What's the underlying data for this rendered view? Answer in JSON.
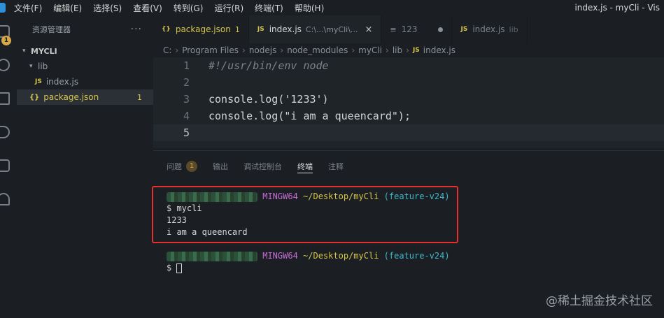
{
  "menu": [
    "文件(F)",
    "编辑(E)",
    "选择(S)",
    "查看(V)",
    "转到(G)",
    "运行(R)",
    "终端(T)",
    "帮助(H)"
  ],
  "window_title": "index.js - myCli - Vis",
  "activity": {
    "badge": "1"
  },
  "sidebar": {
    "title": "资源管理器",
    "more": "···",
    "root": "MYCLI",
    "folder": "lib",
    "file_js": "index.js",
    "file_json": "package.json",
    "file_json_badge": "1",
    "js_icon": "JS",
    "json_icon": "{}"
  },
  "tabs": [
    {
      "icon": "{}",
      "name": "package.json",
      "desc": "1"
    },
    {
      "icon": "JS",
      "name": "index.js",
      "desc": "C:\\...\\myCli\\...",
      "close": "×"
    },
    {
      "icon": "≡",
      "name": "123",
      "desc": ""
    },
    {
      "icon": "JS",
      "name": "index.js",
      "desc": "lib"
    }
  ],
  "breadcrumb": [
    "C:",
    "Program Files",
    "nodejs",
    "node_modules",
    "myCli",
    "lib",
    "index.js"
  ],
  "code": {
    "line_numbers": [
      "1",
      "2",
      "3",
      "4",
      "5"
    ],
    "lines": [
      "#!/usr/bin/env node",
      "",
      "console.log('1233')",
      "console.log(\"i am a queencard\");",
      ""
    ]
  },
  "panel": {
    "tabs": [
      "问题",
      "输出",
      "调试控制台",
      "终端",
      "注释"
    ],
    "problems_badge": "1"
  },
  "terminal": {
    "host_suffix": "MINGW64",
    "path": "~/Desktop/myCli",
    "branch": "(feature-v24)",
    "command": "$ mycli",
    "output1": "1233",
    "output2": "i am a queencard",
    "prompt": "$ "
  },
  "watermark": "@稀土掘金技术社区",
  "colors": {
    "highlight": "#e0322f",
    "path": "#d6c54a",
    "branch": "#3fb9c9",
    "mingw": "#c56bd3"
  }
}
